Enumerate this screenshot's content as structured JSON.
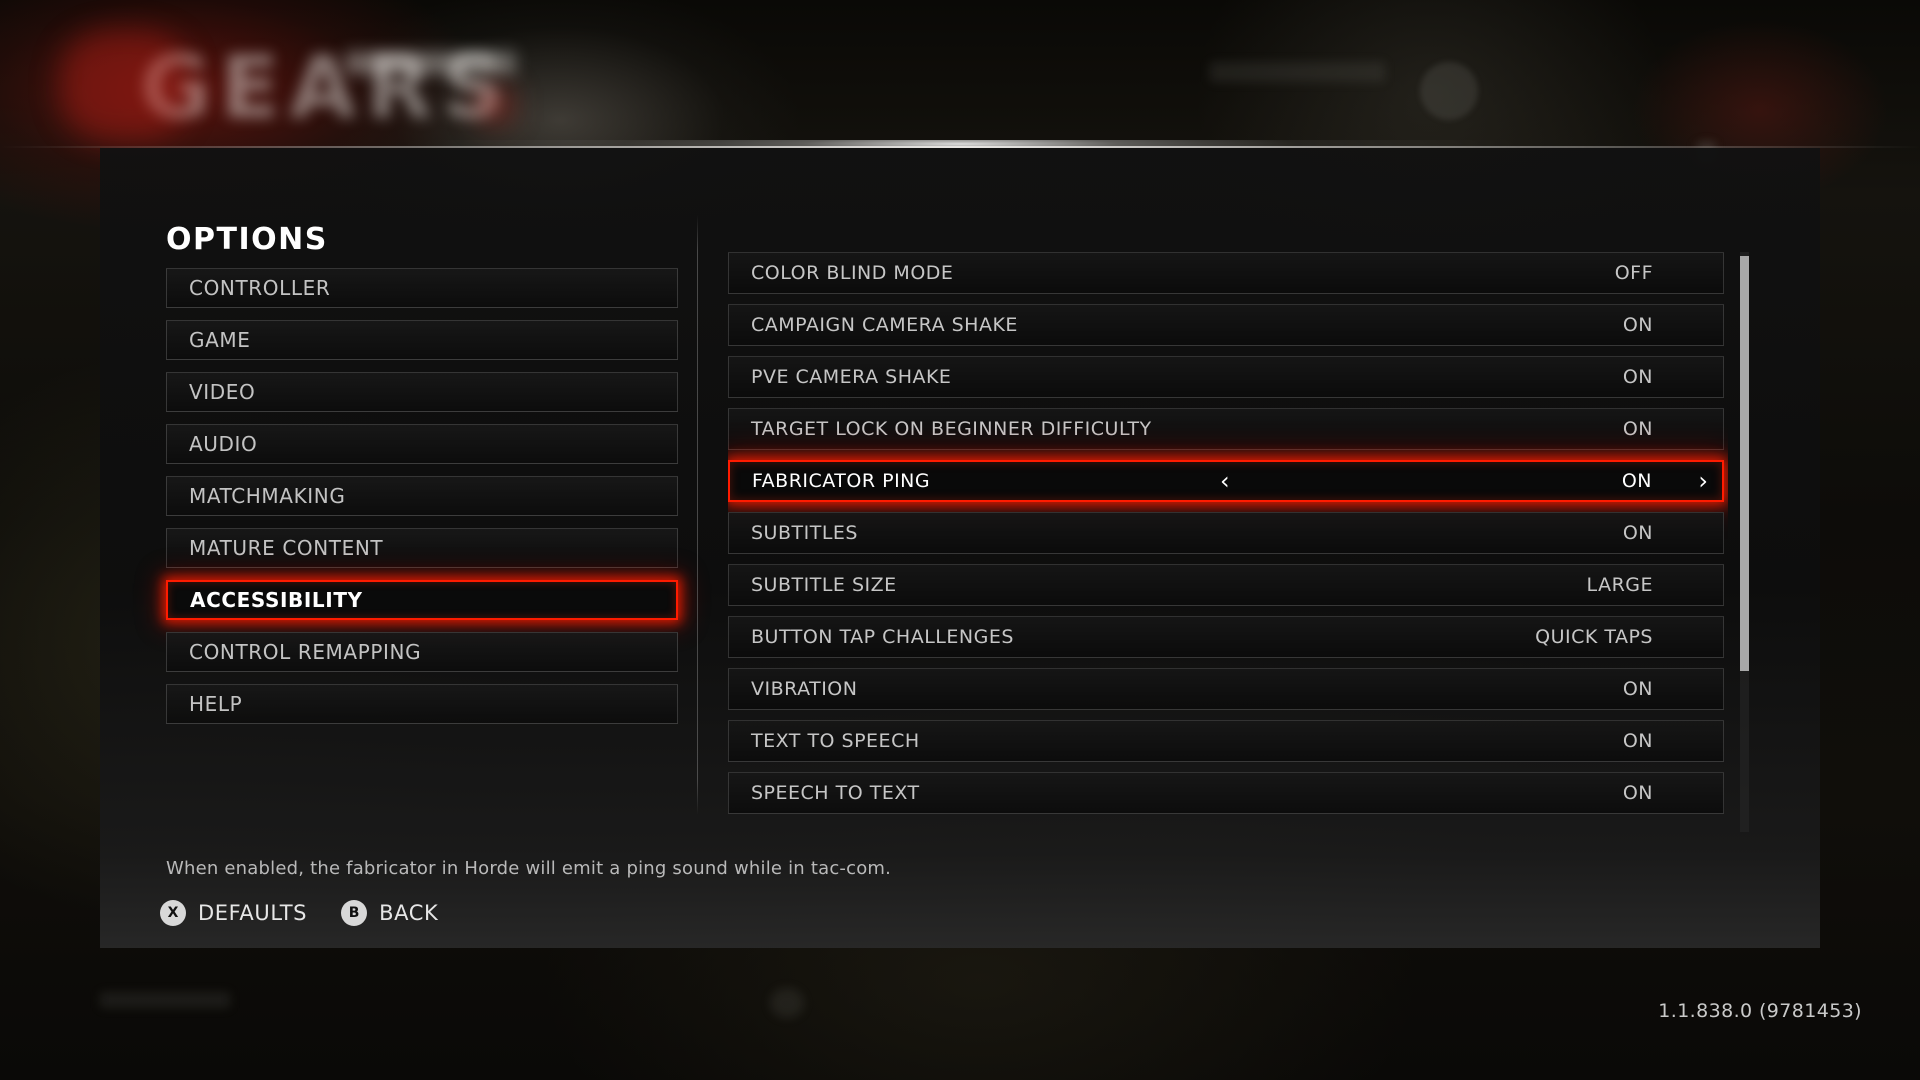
{
  "background": {
    "logo_text": "GEARS",
    "brand_color": "#b4201a"
  },
  "page_title": "OPTIONS",
  "accent_color": "#ff1b00",
  "sidebar": {
    "items": [
      {
        "label": "CONTROLLER",
        "selected": false
      },
      {
        "label": "GAME",
        "selected": false
      },
      {
        "label": "VIDEO",
        "selected": false
      },
      {
        "label": "AUDIO",
        "selected": false
      },
      {
        "label": "MATCHMAKING",
        "selected": false
      },
      {
        "label": "MATURE CONTENT",
        "selected": false
      },
      {
        "label": "ACCESSIBILITY",
        "selected": true
      },
      {
        "label": "CONTROL REMAPPING",
        "selected": false
      },
      {
        "label": "HELP",
        "selected": false
      }
    ]
  },
  "settings": {
    "rows": [
      {
        "label": "COLOR BLIND MODE",
        "value": "OFF",
        "selected": false
      },
      {
        "label": "CAMPAIGN CAMERA SHAKE",
        "value": "ON",
        "selected": false
      },
      {
        "label": "PVE CAMERA SHAKE",
        "value": "ON",
        "selected": false
      },
      {
        "label": "TARGET LOCK ON BEGINNER DIFFICULTY",
        "value": "ON",
        "selected": false
      },
      {
        "label": "FABRICATOR PING",
        "value": "ON",
        "selected": true
      },
      {
        "label": "SUBTITLES",
        "value": "ON",
        "selected": false
      },
      {
        "label": "SUBTITLE SIZE",
        "value": "LARGE",
        "selected": false
      },
      {
        "label": "BUTTON TAP CHALLENGES",
        "value": "QUICK TAPS",
        "selected": false
      },
      {
        "label": "VIBRATION",
        "value": "ON",
        "selected": false
      },
      {
        "label": "TEXT TO SPEECH",
        "value": "ON",
        "selected": false
      },
      {
        "label": "SPEECH TO TEXT",
        "value": "ON",
        "selected": false
      }
    ],
    "decrement_arrow": "‹",
    "increment_arrow": "›"
  },
  "footer": {
    "description": "When enabled, the fabricator in Horde will emit a ping sound while in tac-com.",
    "prompts": [
      {
        "glyph": "X",
        "label": "DEFAULTS"
      },
      {
        "glyph": "B",
        "label": "BACK"
      }
    ]
  },
  "version": "1.1.838.0 (9781453)"
}
